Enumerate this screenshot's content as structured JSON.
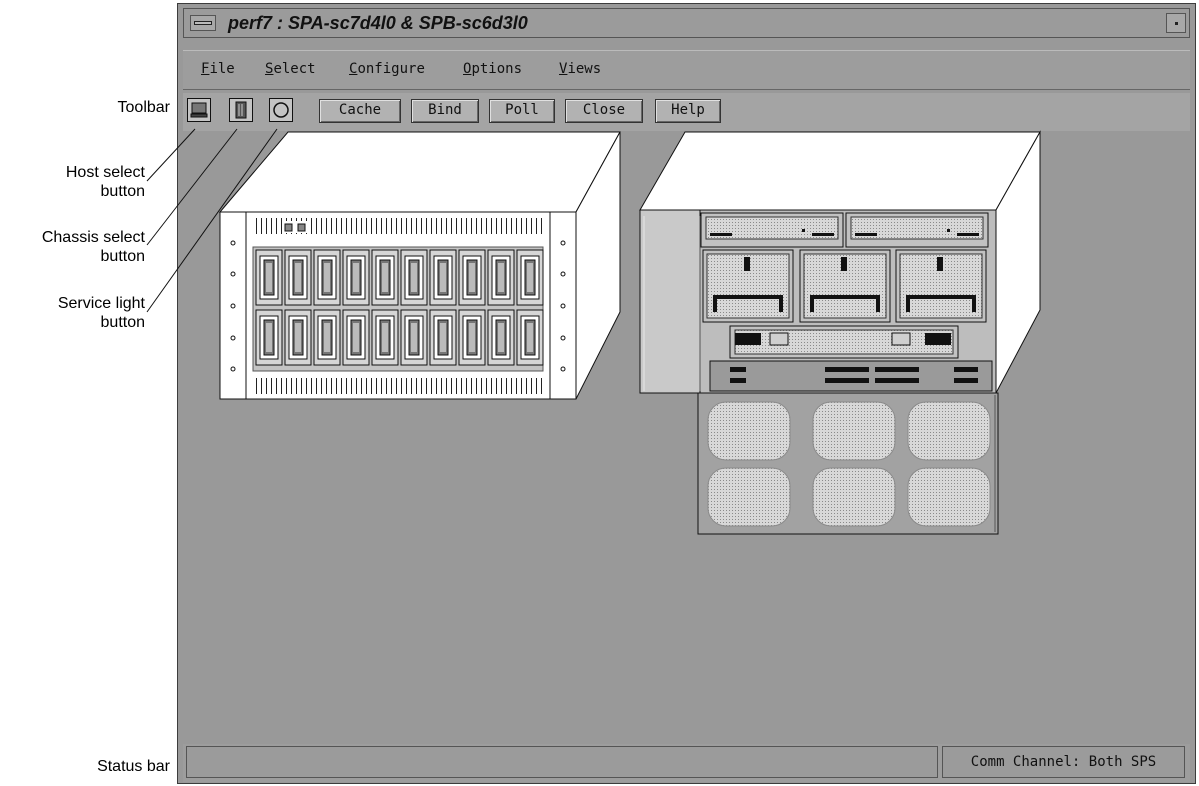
{
  "window": {
    "title": "perf7 : SPA-sc7d4l0 & SPB-sc6d3l0"
  },
  "menubar": {
    "items": [
      {
        "mnemonic": "F",
        "rest": "ile"
      },
      {
        "mnemonic": "S",
        "rest": "elect"
      },
      {
        "mnemonic": "C",
        "rest": "onfigure"
      },
      {
        "mnemonic": "O",
        "rest": "ptions"
      },
      {
        "mnemonic": "V",
        "rest": "iews"
      }
    ]
  },
  "toolbar": {
    "icons": [
      "host-select-icon",
      "chassis-select-icon",
      "service-light-icon"
    ],
    "buttons": [
      "Cache",
      "Bind",
      "Poll",
      "Close",
      "Help"
    ]
  },
  "callouts": {
    "toolbar": "Toolbar",
    "host_select": [
      "Host select",
      "button"
    ],
    "chassis_select": [
      "Chassis select",
      "button"
    ],
    "service_light": [
      "Service light",
      "button"
    ],
    "status_bar": "Status bar"
  },
  "statusbar": {
    "message": "",
    "comm_channel": "Comm Channel: Both SPS"
  },
  "colors": {
    "background": "#999999",
    "chassis_face": "#ffffff",
    "panel": "#c8c8c8"
  }
}
